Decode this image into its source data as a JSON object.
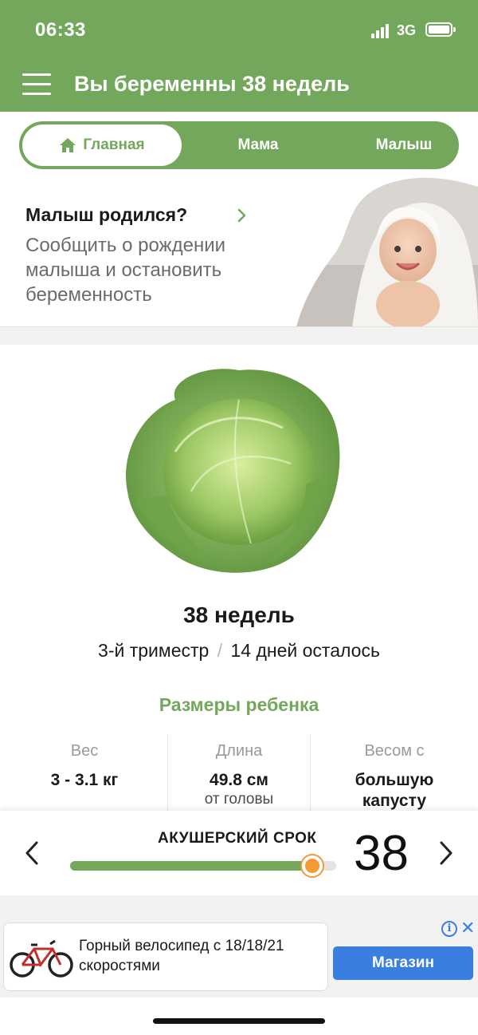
{
  "status_bar": {
    "time": "06:33",
    "network": "3G"
  },
  "header": {
    "title": "Вы беременны 38 недель"
  },
  "tabs": [
    {
      "label": "Главная",
      "active": true,
      "icon": "home-icon"
    },
    {
      "label": "Мама",
      "active": false
    },
    {
      "label": "Малыш",
      "active": false
    }
  ],
  "banner": {
    "title": "Малыш родился?",
    "text": "Сообщить о рождении малыша и остановить беременность"
  },
  "week": {
    "title": "38 недель",
    "trimester": "3-й триместр",
    "separator": "/",
    "remaining": "14 дней осталось"
  },
  "sizes": {
    "title": "Размеры ребенка",
    "weight": {
      "label": "Вес",
      "value": "3 - 3.1 кг"
    },
    "length": {
      "label": "Длина",
      "value": "49.8 см",
      "note": "от головы"
    },
    "compare": {
      "label": "Весом с",
      "value": "большую капусту"
    }
  },
  "tracker": {
    "label": "АКУШЕРСКИЙ СРОК",
    "week": "38",
    "progress": 0.91
  },
  "ad": {
    "text": "Горный велосипед с 18/18/21 скоростями",
    "button": "Магазин",
    "info": "i",
    "close": "✕"
  },
  "colors": {
    "brand_green": "#73a85c",
    "accent_orange": "#f29a36",
    "ad_blue": "#3a7fe0"
  }
}
